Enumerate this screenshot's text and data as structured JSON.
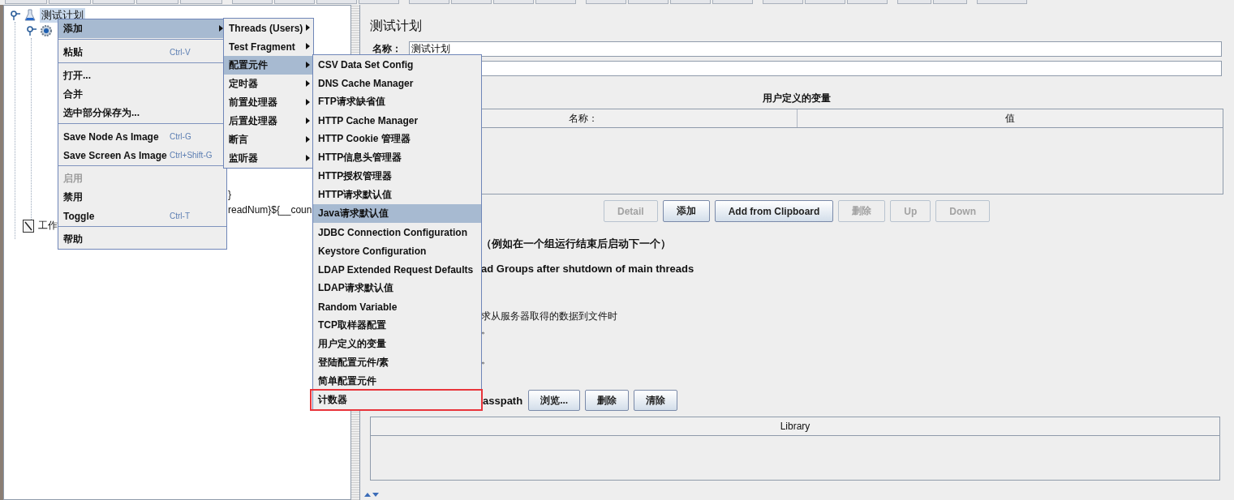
{
  "tree": [
    {
      "label": "测试计划",
      "kind": "plan",
      "selected": true,
      "children": [
        {
          "kind": "gear",
          "selected": false,
          "children": [
            {
              "label": "}",
              "selected": false
            },
            {
              "label": "readNum}${__coun",
              "selected": false
            }
          ]
        }
      ]
    },
    {
      "label": "工作",
      "kind": "notebook",
      "selected": false
    }
  ],
  "panel": {
    "title": "测试计划",
    "name_label": "名称：",
    "name_value": "测试计划",
    "variables": {
      "title": "用户定义的变量",
      "columns": [
        "名称：",
        "值"
      ]
    },
    "buttons": [
      {
        "label": "Detail",
        "disabled": true
      },
      {
        "label": "添加",
        "disabled": false
      },
      {
        "label": "Add from Clipboard",
        "disabled": false
      },
      {
        "label": "删除",
        "disabled": true
      },
      {
        "label": "Up",
        "disabled": true
      },
      {
        "label": "Down",
        "disabled": true
      }
    ],
    "options": [
      {
        "kind": "bold",
        "text": "（例如在一个组运行结束后启动下一个）"
      },
      {
        "kind": "bold",
        "text": "ad Groups after shutdown of main threads"
      },
      {
        "kind": "plain",
        "text": "求从服务器取得的数据到文件时"
      },
      {
        "kind": "plain",
        "text": "。"
      },
      {
        "kind": "plain",
        "text": "。"
      }
    ],
    "classpath": {
      "label": "asspath",
      "buttons": [
        "浏览...",
        "删除",
        "清除"
      ]
    },
    "library": {
      "columns": [
        "Library"
      ]
    }
  },
  "context_menu": [
    {
      "kind": "item",
      "label": "添加",
      "submenu": true,
      "selected": true,
      "disabled": false
    },
    {
      "kind": "separator"
    },
    {
      "kind": "item",
      "label": "粘贴",
      "shortcut": "Ctrl-V",
      "submenu": false,
      "selected": false,
      "disabled": false
    },
    {
      "kind": "separator"
    },
    {
      "kind": "item",
      "label": "打开...",
      "submenu": false,
      "selected": false,
      "disabled": false
    },
    {
      "kind": "item",
      "label": "合并",
      "submenu": false,
      "selected": false,
      "disabled": false
    },
    {
      "kind": "item",
      "label": "选中部分保存为...",
      "submenu": false,
      "selected": false,
      "disabled": false
    },
    {
      "kind": "separator"
    },
    {
      "kind": "item",
      "label": "Save Node As Image",
      "shortcut": "Ctrl-G",
      "submenu": false,
      "selected": false,
      "disabled": false
    },
    {
      "kind": "item",
      "label": "Save Screen As Image",
      "shortcut": "Ctrl+Shift-G",
      "submenu": false,
      "selected": false,
      "disabled": false
    },
    {
      "kind": "separator"
    },
    {
      "kind": "item",
      "label": "启用",
      "submenu": false,
      "selected": false,
      "disabled": true
    },
    {
      "kind": "item",
      "label": "禁用",
      "submenu": false,
      "selected": false,
      "disabled": false
    },
    {
      "kind": "item",
      "label": "Toggle",
      "shortcut": "Ctrl-T",
      "submenu": false,
      "selected": false,
      "disabled": false
    },
    {
      "kind": "separator"
    },
    {
      "kind": "item",
      "label": "帮助",
      "submenu": false,
      "selected": false,
      "disabled": false
    }
  ],
  "add_menu": [
    {
      "label": "Threads (Users)",
      "selected": false
    },
    {
      "label": "Test Fragment",
      "selected": false
    },
    {
      "label": "配置元件",
      "selected": true
    },
    {
      "label": "定时器",
      "selected": false
    },
    {
      "label": "前置处理器",
      "selected": false
    },
    {
      "label": "后置处理器",
      "selected": false
    },
    {
      "label": "断言",
      "selected": false
    },
    {
      "label": "监听器",
      "selected": false
    }
  ],
  "config_menu": [
    {
      "label": "CSV Data Set Config",
      "selected": false,
      "highlighted": false
    },
    {
      "label": "DNS Cache Manager",
      "selected": false,
      "highlighted": false
    },
    {
      "label": "FTP请求缺省值",
      "selected": false,
      "highlighted": false
    },
    {
      "label": "HTTP Cache Manager",
      "selected": false,
      "highlighted": false
    },
    {
      "label": "HTTP Cookie 管理器",
      "selected": false,
      "highlighted": false
    },
    {
      "label": "HTTP信息头管理器",
      "selected": false,
      "highlighted": false
    },
    {
      "label": "HTTP授权管理器",
      "selected": false,
      "highlighted": false
    },
    {
      "label": "HTTP请求默认值",
      "selected": false,
      "highlighted": false
    },
    {
      "label": "Java请求默认值",
      "selected": true,
      "highlighted": false
    },
    {
      "label": "JDBC Connection Configuration",
      "selected": false,
      "highlighted": false
    },
    {
      "label": "Keystore Configuration",
      "selected": false,
      "highlighted": false
    },
    {
      "label": "LDAP Extended Request Defaults",
      "selected": false,
      "highlighted": false
    },
    {
      "label": "LDAP请求默认值",
      "selected": false,
      "highlighted": false
    },
    {
      "label": "Random Variable",
      "selected": false,
      "highlighted": false
    },
    {
      "label": "TCP取样器配置",
      "selected": false,
      "highlighted": false
    },
    {
      "label": "用户定义的变量",
      "selected": false,
      "highlighted": false
    },
    {
      "label": "登陆配置元件/素",
      "selected": false,
      "highlighted": false
    },
    {
      "label": "简单配置元件",
      "selected": false,
      "highlighted": false
    },
    {
      "label": "计数器",
      "selected": false,
      "highlighted": true
    }
  ]
}
